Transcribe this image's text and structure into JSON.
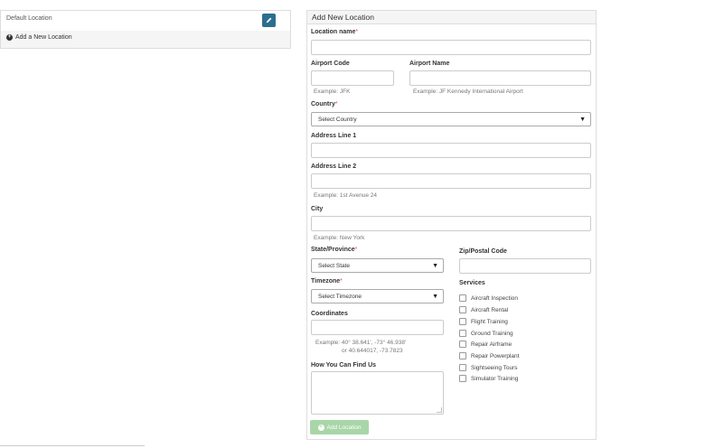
{
  "left": {
    "default_location": "Default Location",
    "add_new": "Add a New Location"
  },
  "form": {
    "title": "Add New Location",
    "location_name_label": "Location name",
    "airport_code_label": "Airport Code",
    "airport_code_help": "Example: JFK",
    "airport_name_label": "Airport Name",
    "airport_name_help": "Example: JF Kennedy International Airport",
    "country_label": "Country",
    "country_select": "Select Country",
    "address1_label": "Address Line 1",
    "address2_label": "Address Line 2",
    "address2_help": "Example: 1st Avenue 24",
    "city_label": "City",
    "city_help": "Example: New York",
    "state_label": "State/Province",
    "state_select": "Select State",
    "zip_label": "Zip/Postal Code",
    "timezone_label": "Timezone",
    "timezone_select": "Select Timezone",
    "coordinates_label": "Coordinates",
    "coordinates_help_1": "Example: 40° 38.641', -73° 46.938'",
    "coordinates_help_2": "or 40.644017, -73.7823",
    "find_us_label": "How You Can Find Us",
    "services_label": "Services",
    "services": [
      "Aircraft Inspection",
      "Aircraft Rental",
      "Flight Training",
      "Ground Training",
      "Repair Airframe",
      "Repair Powerplant",
      "Sightseeing Tours",
      "Simulator Training"
    ],
    "submit_label": "Add Location",
    "required_mark": "*"
  },
  "colors": {
    "edit_button": "#2c6e8f",
    "submit_button": "#a8d6a8",
    "required": "#d9534f"
  }
}
